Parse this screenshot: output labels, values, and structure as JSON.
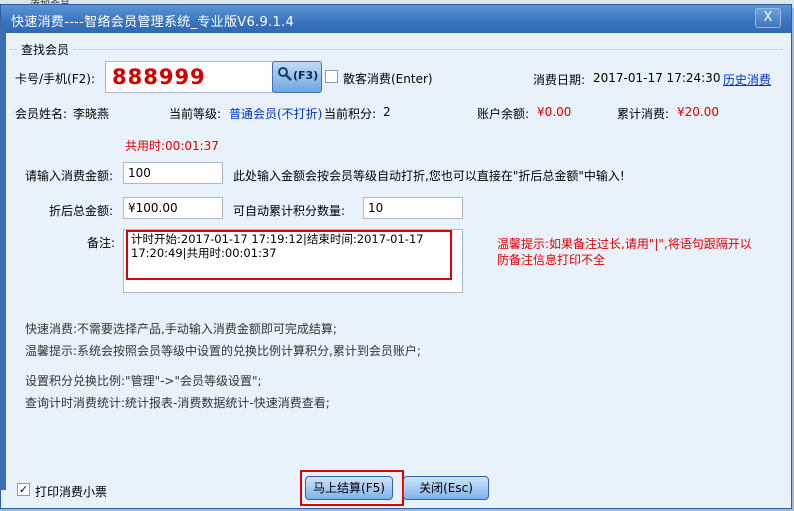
{
  "bg": {
    "top_text": "添加会员"
  },
  "window": {
    "title": "快速消费----智络会员管理系统_专业版V6.9.1.4",
    "close_label": "X"
  },
  "search": {
    "legend": "查找会员",
    "card_label": "卡号/手机(F2):",
    "card_value": "888999",
    "search_button_label": "(F3)",
    "walk_in_label": "散客消费(Enter)",
    "date_label": "消费日期:",
    "date_value": "2017-01-17 17:24:30",
    "history_link": "历史消费"
  },
  "member": {
    "name_label": "会员姓名:",
    "name_value": "李晓燕",
    "level_label": "当前等级:",
    "level_value": "普通会员(不打折)",
    "points_label": "当前积分:",
    "points_value": "2",
    "balance_label": "账户余额:",
    "balance_value": "¥0.00",
    "total_label": "累计消费:",
    "total_value": "¥20.00"
  },
  "timer": {
    "text": "共用时:00:01:37"
  },
  "form": {
    "amount_label": "请输入消费金额:",
    "amount_value": "100",
    "amount_hint": "此处输入金额会按会员等级自动打折,您也可以直接在\"折后总金额\"中输入!",
    "discount_label": "折后总金额:",
    "discount_value": "¥100.00",
    "points_label": "可自动累计积分数量:",
    "points_value": "10",
    "remark_label": "备注:",
    "remark_value": "计时开始:2017-01-17 17:19:12|结束时间:2017-01-17 17:20:49|共用时:00:01:37",
    "remark_tip": "温馨提示:如果备注过长,请用\"|\",将语句跟隔开以防备注信息打印不全"
  },
  "info": {
    "line1": "快速消费:不需要选择产品,手动输入消费金额即可完成结算;",
    "line2": "温馨提示:系统会按照会员等级中设置的兑换比例计算积分,累计到会员账户;",
    "line3": "设置积分兑换比例:\"管理\"->\"会员等级设置\";",
    "line4": "查询计时消费统计:统计报表-消费数据统计-快速消费查看;"
  },
  "footer": {
    "print_label": "打印消费小票",
    "print_checked": "✓",
    "settle_label": "马上结算(F5)",
    "close_label": "关闭(Esc)"
  }
}
